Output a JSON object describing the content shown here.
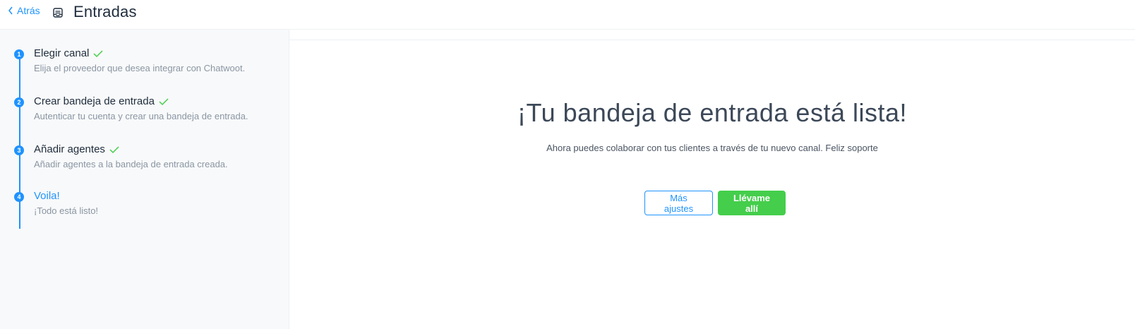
{
  "header": {
    "back_label": "Atrás",
    "title": "Entradas",
    "back_icon": "chevron-left-icon",
    "title_icon": "inbox-icon",
    "accent_color": "#1f93ff"
  },
  "steps": [
    {
      "number": "1",
      "title": "Elegir canal",
      "description": "Elija el proveedor que desea integrar con Chatwoot.",
      "completed": true
    },
    {
      "number": "2",
      "title": "Crear bandeja de entrada",
      "description": "Autenticar tu cuenta y crear una bandeja de entrada.",
      "completed": true
    },
    {
      "number": "3",
      "title": "Añadir agentes",
      "description": "Añadir agentes a la bandeja de entrada creada.",
      "completed": true
    },
    {
      "number": "4",
      "title": "Voila!",
      "description": "¡Todo está listo!",
      "completed": false,
      "active": true
    }
  ],
  "main": {
    "title": "¡Tu bandeja de entrada está lista!",
    "subtitle": "Ahora puedes colaborar con tus clientes a través de tu nuevo canal. Feliz soporte",
    "settings_button": "Más ajustes",
    "go_button": "Llévame allí",
    "success_color": "#44ce4b"
  }
}
